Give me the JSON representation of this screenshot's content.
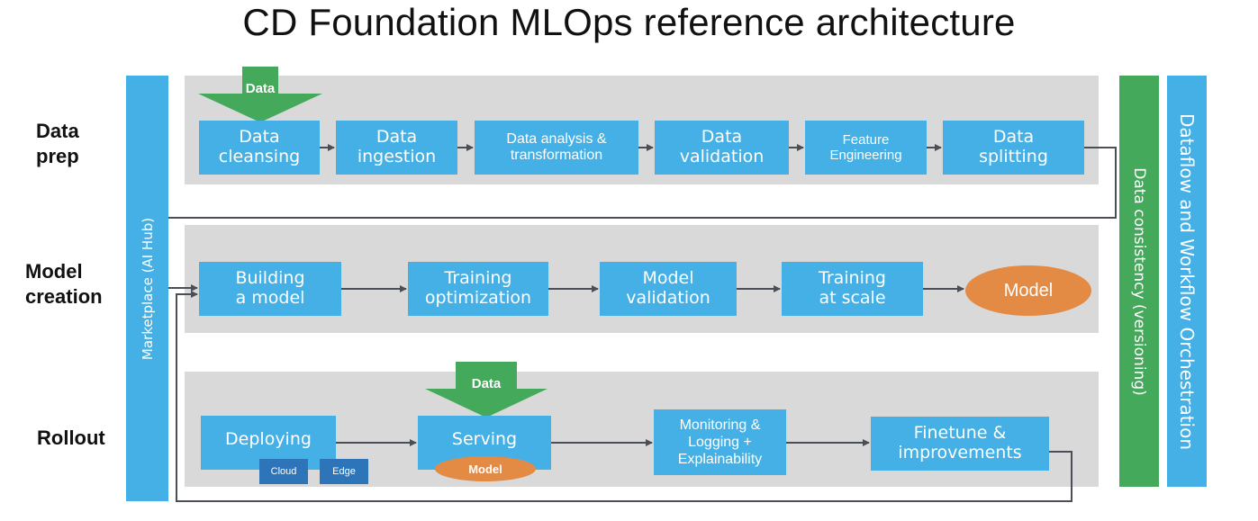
{
  "title": "CD Foundation MLOps reference architecture",
  "colors": {
    "process_box": "#45b0e5",
    "sub_box": "#2d74b8",
    "model_ellipse": "#e38a45",
    "data_arrow": "#44a95a",
    "panel": "#d9d9d9",
    "connector": "#4a4f57"
  },
  "rows": {
    "data_prep": "Data\nprep",
    "model_creation": "Model\ncreation",
    "rollout": "Rollout"
  },
  "side_bars": {
    "marketplace": "Marketplace (AI Hub)",
    "data_consistency": "Data consistency (versioning)",
    "orchestration": "Dataflow and Workflow Orchestration"
  },
  "data_prep": {
    "data_input": "Data",
    "steps": [
      "Data\ncleansing",
      "Data\ningestion",
      "Data analysis &\ntransformation",
      "Data\nvalidation",
      "Feature\nEngineering",
      "Data\nsplitting"
    ]
  },
  "model_creation": {
    "steps": [
      "Building\na model",
      "Training\noptimization",
      "Model\nvalidation",
      "Training\nat scale"
    ],
    "output": "Model"
  },
  "rollout": {
    "deploying": "Deploying",
    "targets": [
      "Cloud",
      "Edge"
    ],
    "data_input": "Data",
    "serving": "Serving",
    "serving_model": "Model",
    "monitoring": "Monitoring &\nLogging +\nExplainability",
    "finetune": "Finetune &\nimprovements"
  }
}
